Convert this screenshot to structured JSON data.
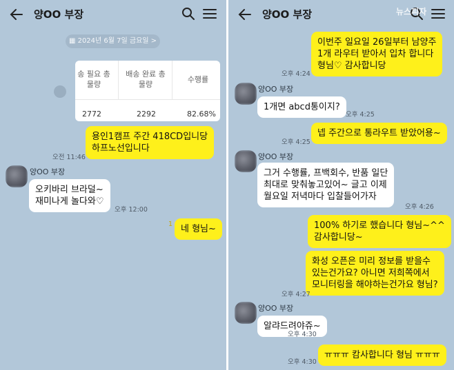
{
  "left": {
    "header": {
      "title": "양OO 부장",
      "back_icon": "back-arrow-icon",
      "search_icon": "search-icon",
      "menu_icon": "hamburger-menu-icon"
    },
    "date_divider": "2024년 6월 7일 금요일 >",
    "table": {
      "headers": [
        "송 필요 총\n물량",
        "배송 완료 총\n물량",
        "수행률"
      ],
      "values": [
        "2772",
        "2292",
        "82.68%"
      ]
    },
    "messages": [
      {
        "side": "me",
        "text": "용인1캠프 주간 418CD입니당\n하프노선입니다",
        "time": "오전 11:46"
      },
      {
        "side": "them",
        "sender": "양OO 부장",
        "text": "오키바리 브라덜~\n재미나게 놀다와♡",
        "time": "오후 12:00"
      },
      {
        "side": "me",
        "text": "네 형님~",
        "unread": "1"
      }
    ]
  },
  "right": {
    "header": {
      "title": "양OO 부장"
    },
    "watermark": "뉴스피자",
    "messages": [
      {
        "side": "me",
        "text": "이번주 일요일 26일부터 남양주\n1개 라우터 받아서 입차 합니다\n형님♡ 감사합니당",
        "time": "오후 4:24"
      },
      {
        "side": "them",
        "sender": "양OO 부장",
        "text": "1개면 abcd통이지?",
        "time": "오후 4:25"
      },
      {
        "side": "me",
        "text": "넵 주간으로 통라우트 받았어용~",
        "time": "오후 4:25"
      },
      {
        "side": "them",
        "sender": "양OO 부장",
        "text": "그거 수행률, 프백회수, 반품 일단\n최대로 맞춰놓고있어~ 글고 이제\n월요일 저녁마다 입찰들어가자",
        "time": "오후 4:26"
      },
      {
        "side": "me",
        "text": "100% 하기로 했습니다 형님~^^\n감사합니당~"
      },
      {
        "side": "me",
        "text": "화성 오픈은 미리 정보를 받을수\n있는건가요? 아니면 저희쪽에서\n모니터링을 해야하는건가요 형님?",
        "time": "오후 4:27"
      },
      {
        "side": "them",
        "sender": "양OO 부장",
        "text": "알랴드려야쥬~",
        "time": "오후 4:30"
      },
      {
        "side": "me",
        "text": "ㅠㅠㅠ 캄사합니다 형님 ㅠㅠㅠ",
        "time": "오후 4:30"
      }
    ]
  },
  "colors": {
    "background": "#b2c7d9",
    "my_bubble": "#fef01b",
    "their_bubble": "#ffffff"
  }
}
